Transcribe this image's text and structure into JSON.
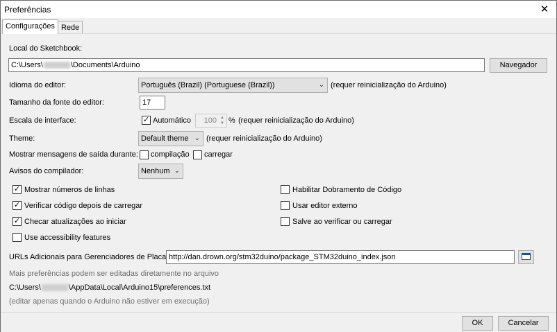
{
  "window": {
    "title": "Preferências",
    "close": "✕"
  },
  "tabs": [
    {
      "label": "Configurações"
    },
    {
      "label": "Rede"
    }
  ],
  "sketchbook": {
    "label": "Local do Sketchbook:",
    "path_prefix": "C:\\Users\\",
    "path_suffix": "\\Documents\\Arduino",
    "browse_button": "Navegador"
  },
  "editor_language": {
    "label": "Idioma do editor:",
    "value": "Português (Brazil) (Portuguese (Brazil))",
    "note": "(requer reinicialização do Arduino)"
  },
  "font_size": {
    "label": "Tamanho da fonte do editor:",
    "value": "17"
  },
  "interface_scale": {
    "label": "Escala de interface:",
    "auto_label": "Automático",
    "auto_checked": true,
    "value": "100",
    "unit": "%",
    "note": "(requer reinicialização do Arduino)"
  },
  "theme": {
    "label": "Theme:",
    "value": "Default theme",
    "note": "(requer reinicialização do Arduino)"
  },
  "verbose_output": {
    "label": "Mostrar mensagens de saída durante:",
    "compile": "compilação",
    "upload": "carregar"
  },
  "compiler_warnings": {
    "label": "Avisos do compilador:",
    "value": "Nenhum"
  },
  "options_left": [
    {
      "label": "Mostrar números de linhas",
      "checked": true
    },
    {
      "label": "Verificar código depois de carregar",
      "checked": true
    },
    {
      "label": "Checar atualizações ao iniciar",
      "checked": true
    },
    {
      "label": "Use accessibility features",
      "checked": false
    }
  ],
  "options_right": [
    {
      "label": "Habilitar Dobramento de Código",
      "checked": false
    },
    {
      "label": "Usar editor externo",
      "checked": false
    },
    {
      "label": "Salve ao verificar ou carregar",
      "checked": false
    }
  ],
  "board_urls": {
    "label": "URLs Adicionais para Gerenciadores de Placas:",
    "value": "http://dan.drown.org/stm32duino/package_STM32duino_index.json"
  },
  "more_prefs": {
    "text": "Mais preferências podem ser editadas diretamente no arquivo",
    "path_prefix": "C:\\Users\\",
    "path_suffix": "\\AppData\\Local\\Arduino15\\preferences.txt",
    "note": "(editar apenas quando o Arduino não estiver em execução)"
  },
  "footer": {
    "ok": "OK",
    "cancel": "Cancelar"
  },
  "check_glyph": "✓"
}
